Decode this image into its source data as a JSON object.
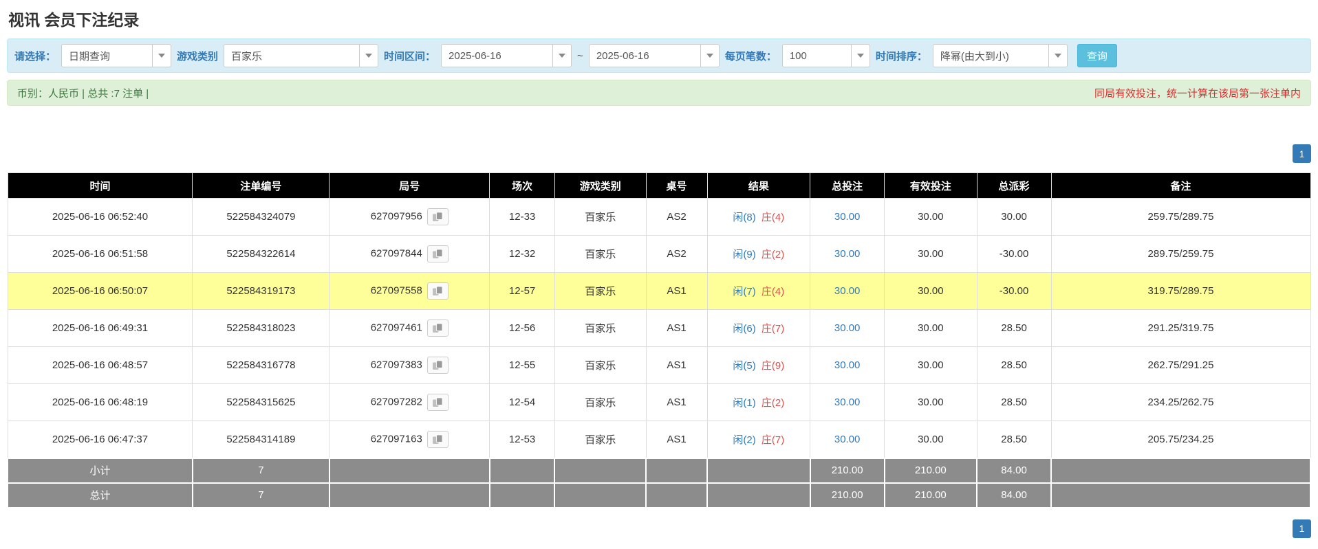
{
  "page": {
    "title": "视讯 会员下注纪录"
  },
  "filter_bar": {
    "select_label": "请选择：",
    "select_value": "日期查询",
    "game_type_label": "游戏类别",
    "game_type_value": "百家乐",
    "time_range_label": "时间区间：",
    "date_from": "2025-06-16",
    "range_separator": "~",
    "date_to": "2025-06-16",
    "page_size_label": "每页笔数：",
    "page_size_value": "100",
    "sort_label": "时间排序：",
    "sort_value": "降幂(由大到小)",
    "search_button_label": "查询"
  },
  "summary_bar": {
    "currency_info": "币别：人民币 | 总共 :7 注单 |",
    "notice": "同局有效投注，统一计算在该局第一张注单内"
  },
  "pagination": {
    "current_page": "1"
  },
  "table": {
    "headers": {
      "time": "时间",
      "bet_no": "注单编号",
      "round_no": "局号",
      "session": "场次",
      "game_type": "游戏类别",
      "table_no": "桌号",
      "result": "结果",
      "total_bet": "总投注",
      "valid_bet": "有效投注",
      "total_payout": "总派彩",
      "remark": "备注"
    },
    "rows": [
      {
        "time": "2025-06-16 06:52:40",
        "bet_no": "522584324079",
        "round_no": "627097956",
        "session": "12-33",
        "game_type": "百家乐",
        "table_no": "AS2",
        "result_player": "闲(8)",
        "result_banker": "庄(4)",
        "total_bet": "30.00",
        "valid_bet": "30.00",
        "total_payout": "30.00",
        "remark": "259.75/289.75",
        "highlight": false
      },
      {
        "time": "2025-06-16 06:51:58",
        "bet_no": "522584322614",
        "round_no": "627097844",
        "session": "12-32",
        "game_type": "百家乐",
        "table_no": "AS2",
        "result_player": "闲(9)",
        "result_banker": "庄(2)",
        "total_bet": "30.00",
        "valid_bet": "30.00",
        "total_payout": "-30.00",
        "remark": "289.75/259.75",
        "highlight": false
      },
      {
        "time": "2025-06-16 06:50:07",
        "bet_no": "522584319173",
        "round_no": "627097558",
        "session": "12-57",
        "game_type": "百家乐",
        "table_no": "AS1",
        "result_player": "闲(7)",
        "result_banker": "庄(4)",
        "total_bet": "30.00",
        "valid_bet": "30.00",
        "total_payout": "-30.00",
        "remark": "319.75/289.75",
        "highlight": true
      },
      {
        "time": "2025-06-16 06:49:31",
        "bet_no": "522584318023",
        "round_no": "627097461",
        "session": "12-56",
        "game_type": "百家乐",
        "table_no": "AS1",
        "result_player": "闲(6)",
        "result_banker": "庄(7)",
        "total_bet": "30.00",
        "valid_bet": "30.00",
        "total_payout": "28.50",
        "remark": "291.25/319.75",
        "highlight": false
      },
      {
        "time": "2025-06-16 06:48:57",
        "bet_no": "522584316778",
        "round_no": "627097383",
        "session": "12-55",
        "game_type": "百家乐",
        "table_no": "AS1",
        "result_player": "闲(5)",
        "result_banker": "庄(9)",
        "total_bet": "30.00",
        "valid_bet": "30.00",
        "total_payout": "28.50",
        "remark": "262.75/291.25",
        "highlight": false
      },
      {
        "time": "2025-06-16 06:48:19",
        "bet_no": "522584315625",
        "round_no": "627097282",
        "session": "12-54",
        "game_type": "百家乐",
        "table_no": "AS1",
        "result_player": "闲(1)",
        "result_banker": "庄(2)",
        "total_bet": "30.00",
        "valid_bet": "30.00",
        "total_payout": "28.50",
        "remark": "234.25/262.75",
        "highlight": false
      },
      {
        "time": "2025-06-16 06:47:37",
        "bet_no": "522584314189",
        "round_no": "627097163",
        "session": "12-53",
        "game_type": "百家乐",
        "table_no": "AS1",
        "result_player": "闲(2)",
        "result_banker": "庄(7)",
        "total_bet": "30.00",
        "valid_bet": "30.00",
        "total_payout": "28.50",
        "remark": "205.75/234.25",
        "highlight": false
      }
    ],
    "subtotal_row": {
      "label": "小计",
      "count": "7",
      "total_bet": "210.00",
      "valid_bet": "210.00",
      "total_payout": "84.00"
    },
    "total_row": {
      "label": "总计",
      "count": "7",
      "total_bet": "210.00",
      "valid_bet": "210.00",
      "total_payout": "84.00"
    }
  },
  "colors": {
    "accent_blue": "#337ab7",
    "info_bg": "#d9edf7",
    "info_border": "#bce8f1",
    "success_bg": "#dff0d8",
    "success_border": "#d6e9c6",
    "success_text": "#3c763d",
    "notice_red": "#e02b2b",
    "header_bg": "#000000",
    "footer_bg": "#8c8c8c",
    "highlight_yellow": "#ffff99",
    "negative_red": "#e02b2b",
    "player_blue": "#337ab7",
    "banker_red": "#d9534f",
    "button_info": "#5bc0de"
  }
}
